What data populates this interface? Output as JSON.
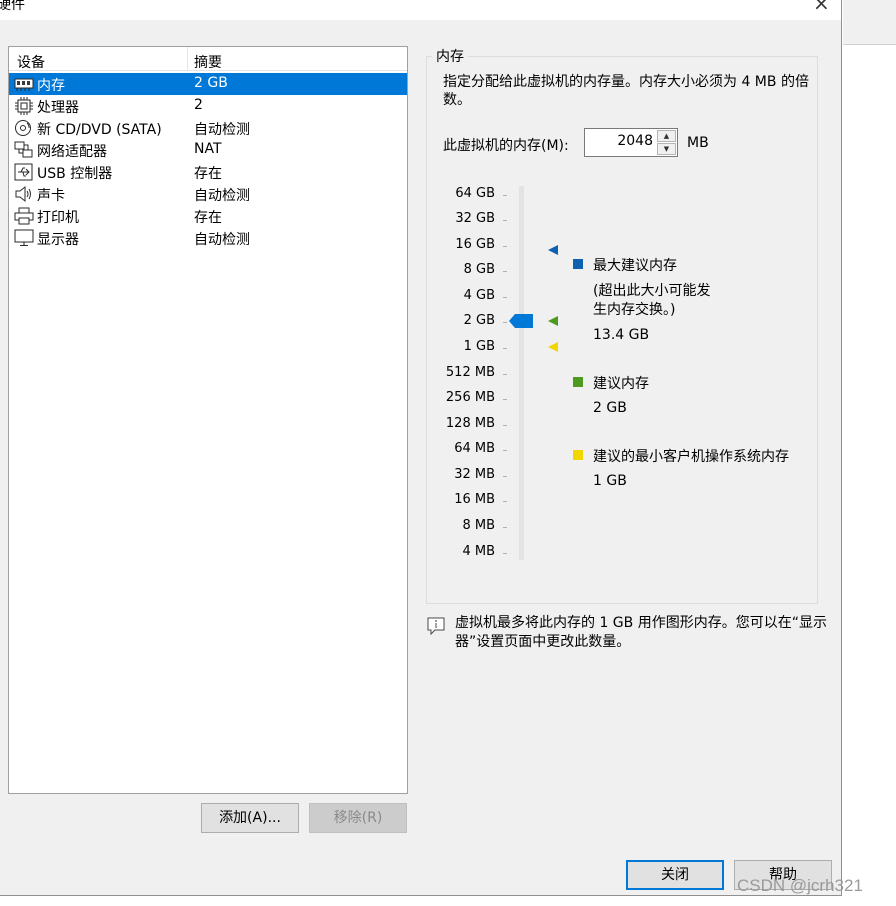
{
  "window": {
    "title": "硬件",
    "close_glyph": "×"
  },
  "devices": {
    "columns": [
      "设备",
      "摘要"
    ],
    "items": [
      {
        "name": "内存",
        "summary": "2 GB",
        "icon": "memory-icon",
        "selected": true
      },
      {
        "name": "处理器",
        "summary": "2",
        "icon": "processor-icon"
      },
      {
        "name": "新 CD/DVD (SATA)",
        "summary": "自动检测",
        "icon": "cd-dvd-icon"
      },
      {
        "name": "网络适配器",
        "summary": "NAT",
        "icon": "network-adapter-icon"
      },
      {
        "name": "USB 控制器",
        "summary": "存在",
        "icon": "usb-controller-icon"
      },
      {
        "name": "声卡",
        "summary": "自动检测",
        "icon": "sound-card-icon"
      },
      {
        "name": "打印机",
        "summary": "存在",
        "icon": "printer-icon"
      },
      {
        "name": "显示器",
        "summary": "自动检测",
        "icon": "display-icon"
      }
    ],
    "add_label": "添加(A)...",
    "remove_label": "移除(R)"
  },
  "memory": {
    "group_title": "内存",
    "description": "指定分配给此虚拟机的内存量。内存大小必须为 4 MB 的倍数。",
    "field_label": "此虚拟机的内存(M):",
    "value": "2048",
    "unit": "MB",
    "scale": [
      "64 GB",
      "32 GB",
      "16 GB",
      "8 GB",
      "4 GB",
      "2 GB",
      "1 GB",
      "512 MB",
      "256 MB",
      "128 MB",
      "64 MB",
      "32 MB",
      "16 MB",
      "8 MB",
      "4 MB"
    ],
    "legend": {
      "max": {
        "label": "最大建议内存",
        "note": "(超出此大小可能发生内存交换。)",
        "value": "13.4 GB",
        "color": "#1060b0"
      },
      "recommended": {
        "label": "建议内存",
        "value": "2 GB",
        "color": "#4c9a1e"
      },
      "min_guest": {
        "label": "建议的最小客户机操作系统内存",
        "value": "1 GB",
        "color": "#f2d600"
      }
    },
    "info": "虚拟机最多将此内存的 1 GB 用作图形内存。您可以在“显示器”设置页面中更改此数量。"
  },
  "footer": {
    "close_label": "关闭",
    "help_label": "帮助"
  },
  "watermark": "CSDN @jcrh321",
  "colors": {
    "selection": "#0078d7",
    "thumb": "#0078d7"
  }
}
